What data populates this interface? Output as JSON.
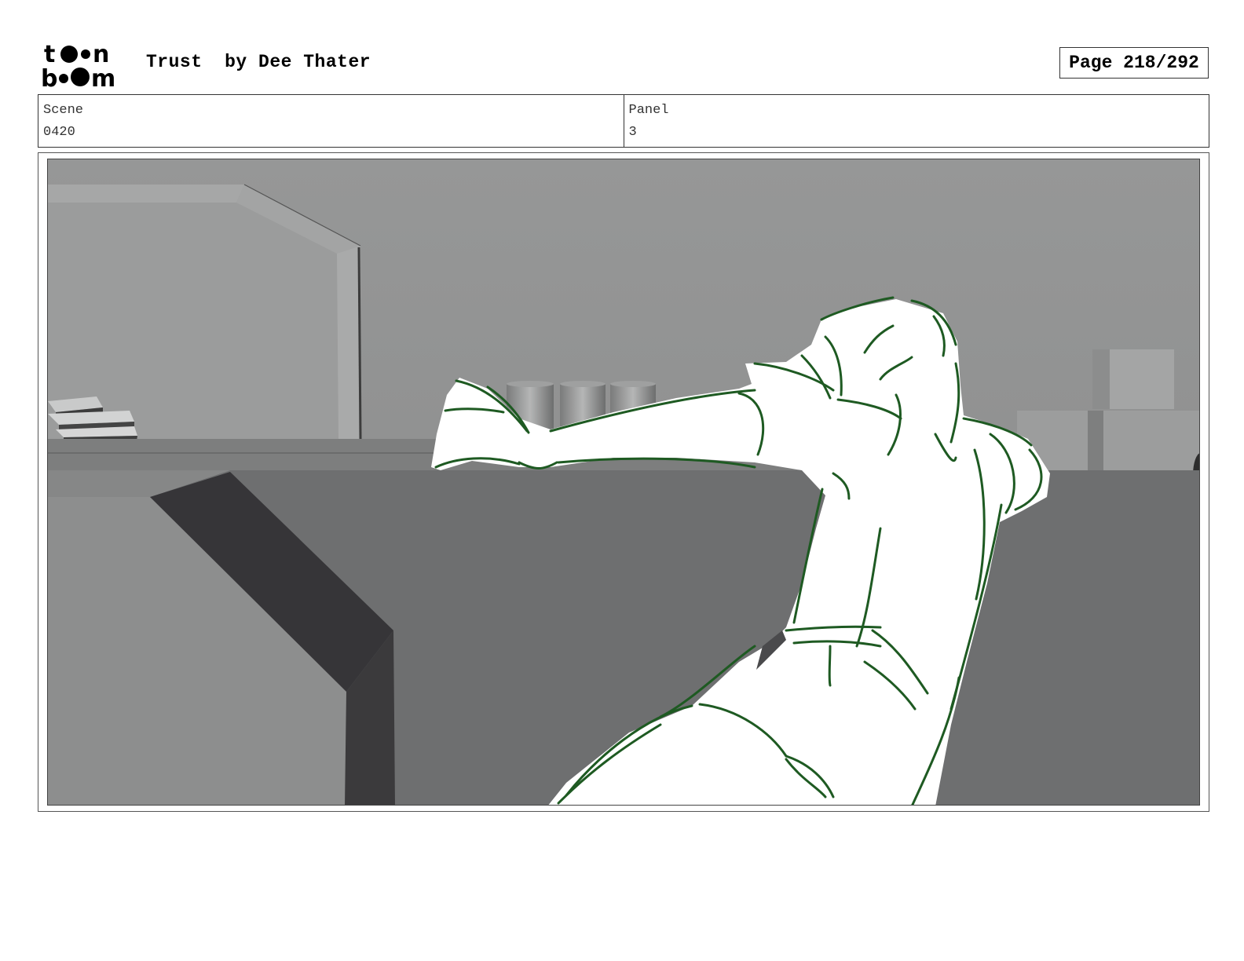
{
  "header": {
    "logo_text": "toon boom",
    "title": "Trust  by Dee Thater",
    "page_label": "Page 218/292"
  },
  "info": {
    "scene_label": "Scene",
    "scene_value": "0420",
    "panel_label": "Panel",
    "panel_value": "3"
  },
  "colors": {
    "sketch_line": "#1e5a22",
    "wall": "#8f9090",
    "floor": "#6e6f70",
    "shadow": "#3b3a3c"
  }
}
